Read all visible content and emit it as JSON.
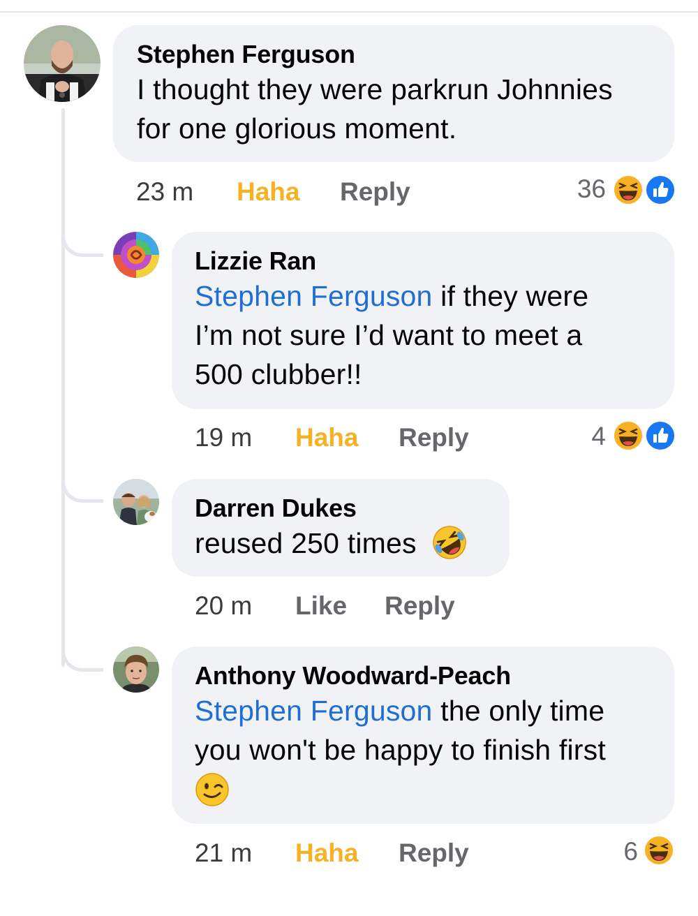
{
  "comments": [
    {
      "author": "Stephen Ferguson",
      "mention": "",
      "text_line1": "I thought they were parkrun Johnnies",
      "text_line2": "for one glorious moment.",
      "text_line3": "",
      "time": "23 m",
      "reaction_label": "Haha",
      "reply_label": "Reply",
      "reaction_count": "36",
      "reaction_icons": [
        "haha-icon",
        "like-icon"
      ]
    },
    {
      "author": "Lizzie Ran",
      "mention": "Stephen Ferguson",
      "text_line1": " if they were",
      "text_line2": "I’m not sure I’d want to meet a",
      "text_line3": "500 clubber!!",
      "time": "19 m",
      "reaction_label": "Haha",
      "reply_label": "Reply",
      "reaction_count": "4",
      "reaction_icons": [
        "haha-icon",
        "like-icon"
      ]
    },
    {
      "author": "Darren Dukes",
      "mention": "",
      "text_line1": "reused 250 times",
      "inline_emoji": "rolling-laughing-emoji",
      "time": "20 m",
      "reaction_label": "Like",
      "reply_label": "Reply"
    },
    {
      "author": "Anthony Woodward-Peach",
      "mention": "Stephen Ferguson",
      "text_line1": " the only time",
      "text_line2": "you won't be happy to finish first",
      "inline_emoji": "winking-emoji",
      "time": "21 m",
      "reaction_label": "Haha",
      "reply_label": "Reply",
      "reaction_count": "6",
      "reaction_icons": [
        "haha-icon"
      ]
    }
  ],
  "colors": {
    "bubble": "#f0f2f5",
    "mention": "#1f6ed4",
    "haha": "#f7b125",
    "like": "#1877f2",
    "muted": "#65676b"
  }
}
